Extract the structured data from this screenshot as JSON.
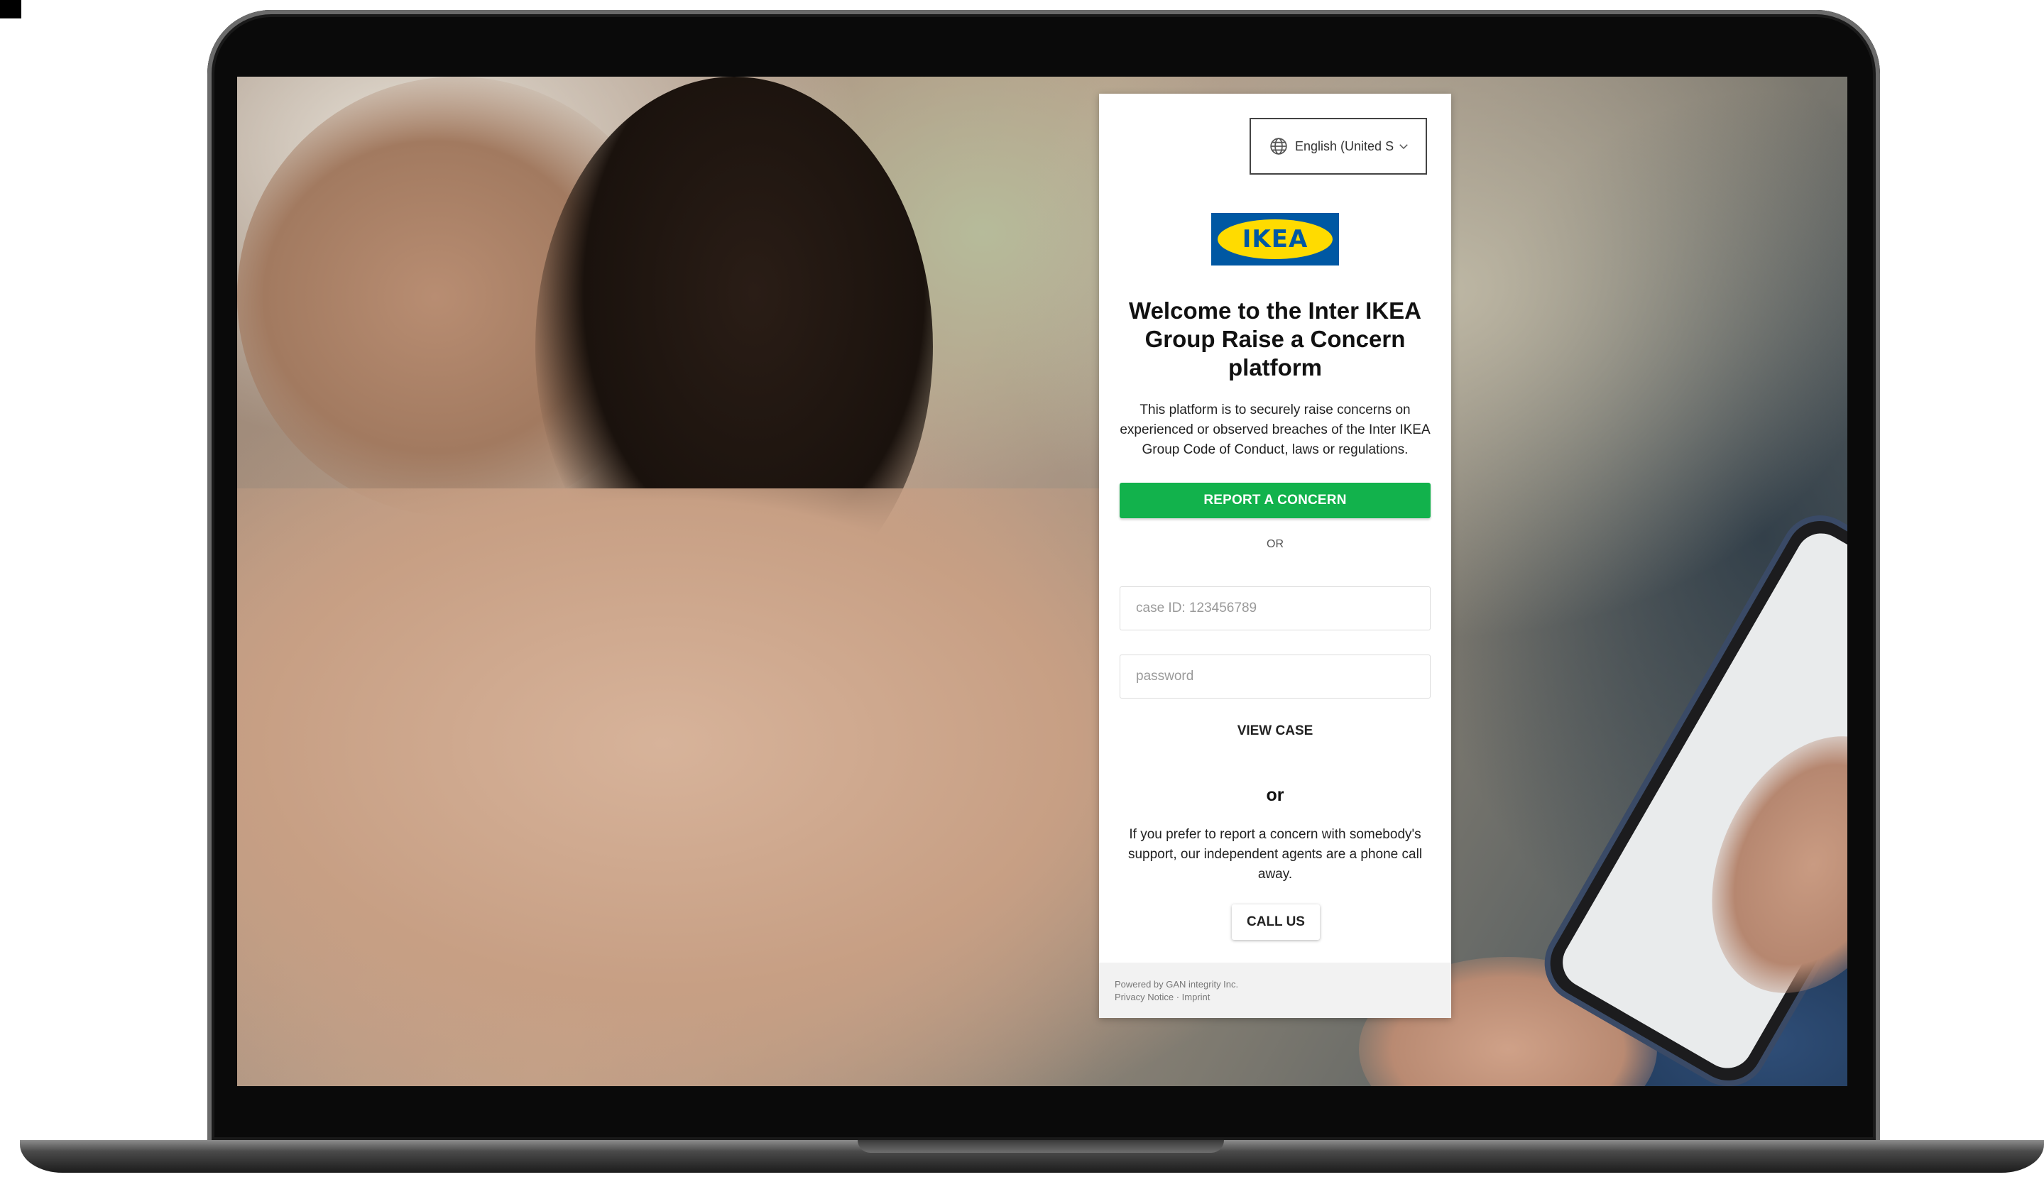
{
  "language_selector": {
    "value": "English (United S",
    "icon": "globe-icon"
  },
  "logo": {
    "text": "IKEA",
    "colors": {
      "background": "#0058a3",
      "oval": "#ffdb00"
    }
  },
  "title": "Welcome to the Inter IKEA Group Raise a Concern platform",
  "intro": "This platform is to securely raise concerns on experienced or observed breaches of the Inter IKEA Group Code of Conduct, laws or regulations.",
  "report_button": {
    "label": "REPORT A CONCERN",
    "color": "#12b24c"
  },
  "or_small": "OR",
  "case_id_field": {
    "placeholder": "case ID: 123456789",
    "value": ""
  },
  "password_field": {
    "placeholder": "password",
    "value": ""
  },
  "view_case_button": {
    "label": "VIEW CASE"
  },
  "or_big": "or",
  "phone_text": "If you prefer to report a concern with somebody's support, our independent agents are a phone call away.",
  "call_button": {
    "label": "CALL US"
  },
  "footer": {
    "powered_by": "Powered by GAN integrity Inc.",
    "privacy_link": "Privacy Notice",
    "separator": "·",
    "imprint_link": "Imprint"
  }
}
